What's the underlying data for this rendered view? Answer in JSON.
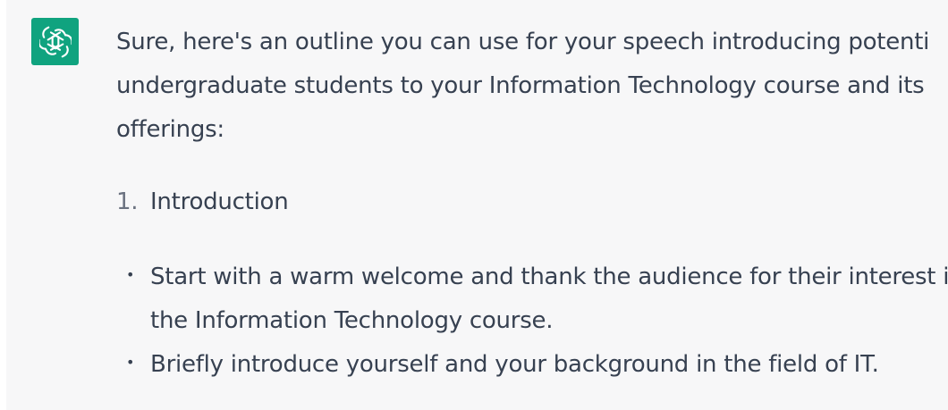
{
  "avatar": {
    "icon": "openai-logo-icon",
    "background": "#10a37f"
  },
  "message": {
    "intro_lines": [
      "Sure, here's an outline you can use for your speech introducing potential",
      "undergraduate students to your Information Technology course and its",
      "offerings:"
    ],
    "ordered_items": [
      {
        "number": "1.",
        "label": "Introduction"
      }
    ],
    "bullets": [
      {
        "marker": "•",
        "lines": [
          "Start with a warm welcome and thank the audience for their interest in",
          "the Information Technology course."
        ]
      },
      {
        "marker": "•",
        "lines": [
          "Briefly introduce yourself and your background in the field of IT."
        ]
      }
    ]
  },
  "colors": {
    "page_background": "#f7f7f8",
    "text": "#374151",
    "muted_text": "#6b7280"
  }
}
